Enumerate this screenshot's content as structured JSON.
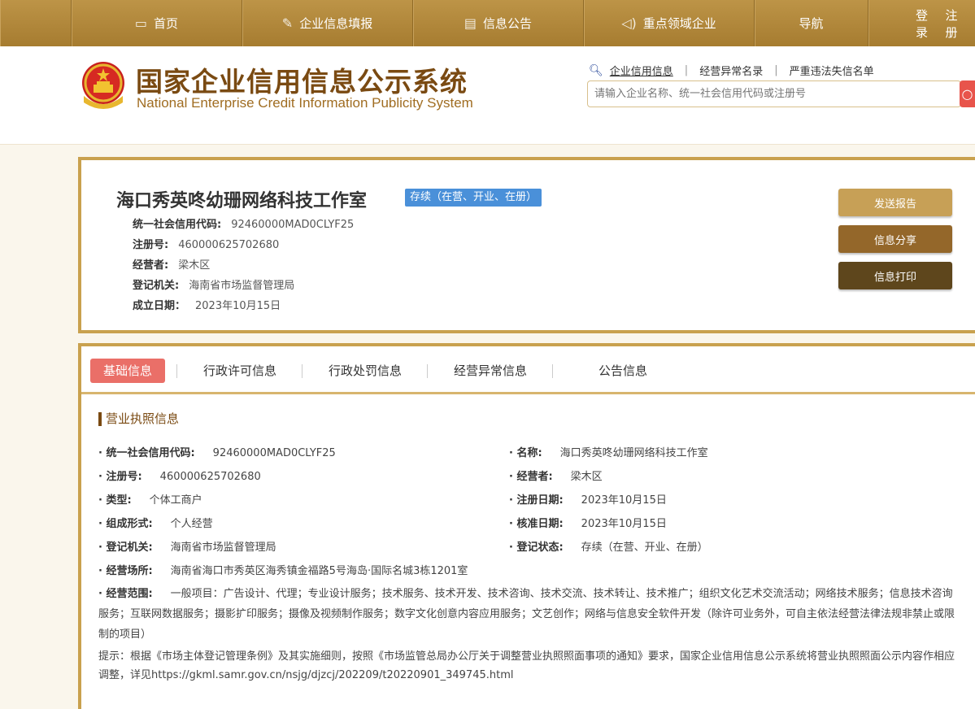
{
  "nav": {
    "home": "首页",
    "fill": "企业信息填报",
    "notice": "信息公告",
    "key": "重点领域企业",
    "guide": "导航",
    "login": "登录",
    "register": "注册"
  },
  "header": {
    "title_cn": "国家企业信用信息公示系统",
    "title_en": "National Enterprise Credit Information Publicity System",
    "search_tabs": [
      "企业信用信息",
      "经营异常名录",
      "严重违法失信名单"
    ],
    "search_placeholder": "请输入企业名称、统一社会信用代码或注册号"
  },
  "company": {
    "name": "海口秀英咚幼珊网络科技工作室",
    "status": "存续（在营、开业、在册）",
    "fields": [
      {
        "label": "统一社会信用代码:",
        "value": "92460000MAD0CLYF25"
      },
      {
        "label": "注册号:",
        "value": "460000625702680"
      },
      {
        "label": "经营者:",
        "value": "梁木区"
      },
      {
        "label": "登记机关:",
        "value": "海南省市场监督管理局"
      },
      {
        "label": "成立日期：",
        "value": "2023年10月15日"
      }
    ],
    "buttons": {
      "send": "发送报告",
      "share": "信息分享",
      "print": "信息打印"
    }
  },
  "tabs": [
    "基础信息",
    "行政许可信息",
    "行政处罚信息",
    "经营异常信息",
    "公告信息"
  ],
  "license": {
    "title": "营业执照信息",
    "left": [
      {
        "label": "统一社会信用代码:",
        "value": "92460000MAD0CLYF25"
      },
      {
        "label": "注册号:",
        "value": "460000625702680"
      },
      {
        "label": "类型:",
        "value": "个体工商户"
      },
      {
        "label": "组成形式:",
        "value": "个人经营"
      },
      {
        "label": "登记机关:",
        "value": "海南省市场监督管理局"
      },
      {
        "label": "经营场所:",
        "value": "海南省海口市秀英区海秀镇金福路5号海岛·国际名城3栋1201室"
      }
    ],
    "right": [
      {
        "label": "名称:",
        "value": "海口秀英咚幼珊网络科技工作室"
      },
      {
        "label": "经营者:",
        "value": "梁木区"
      },
      {
        "label": "注册日期:",
        "value": "2023年10月15日"
      },
      {
        "label": "核准日期:",
        "value": "2023年10月15日"
      },
      {
        "label": "登记状态:",
        "value": "存续（在营、开业、在册）"
      }
    ],
    "scope_label": "经营范围:",
    "scope_value": "一般项目：广告设计、代理；专业设计服务；技术服务、技术开发、技术咨询、技术交流、技术转让、技术推广；组织文化艺术交流活动；网络技术服务；信息技术咨询服务；互联网数据服务；摄影扩印服务；摄像及视频制作服务；数字文化创意内容应用服务；文艺创作；网络与信息安全软件开发（除许可业务外，可自主依法经营法律法规非禁止或限制的项目）",
    "tip": "提示：根据《市场主体登记管理条例》及其实施细则，按照《市场监管总局办公厅关于调整营业执照照面事项的通知》要求，国家企业信用信息公示系统将营业执照照面公示内容作相应调整，详见https://gkml.samr.gov.cn/nsjg/djzcj/202209/t20220901_349745.html"
  },
  "colors": {
    "nav": "#b48a3c",
    "accent": "#c9a14e",
    "badge": "#4a90d9",
    "active_tab": "#ea6f68"
  }
}
